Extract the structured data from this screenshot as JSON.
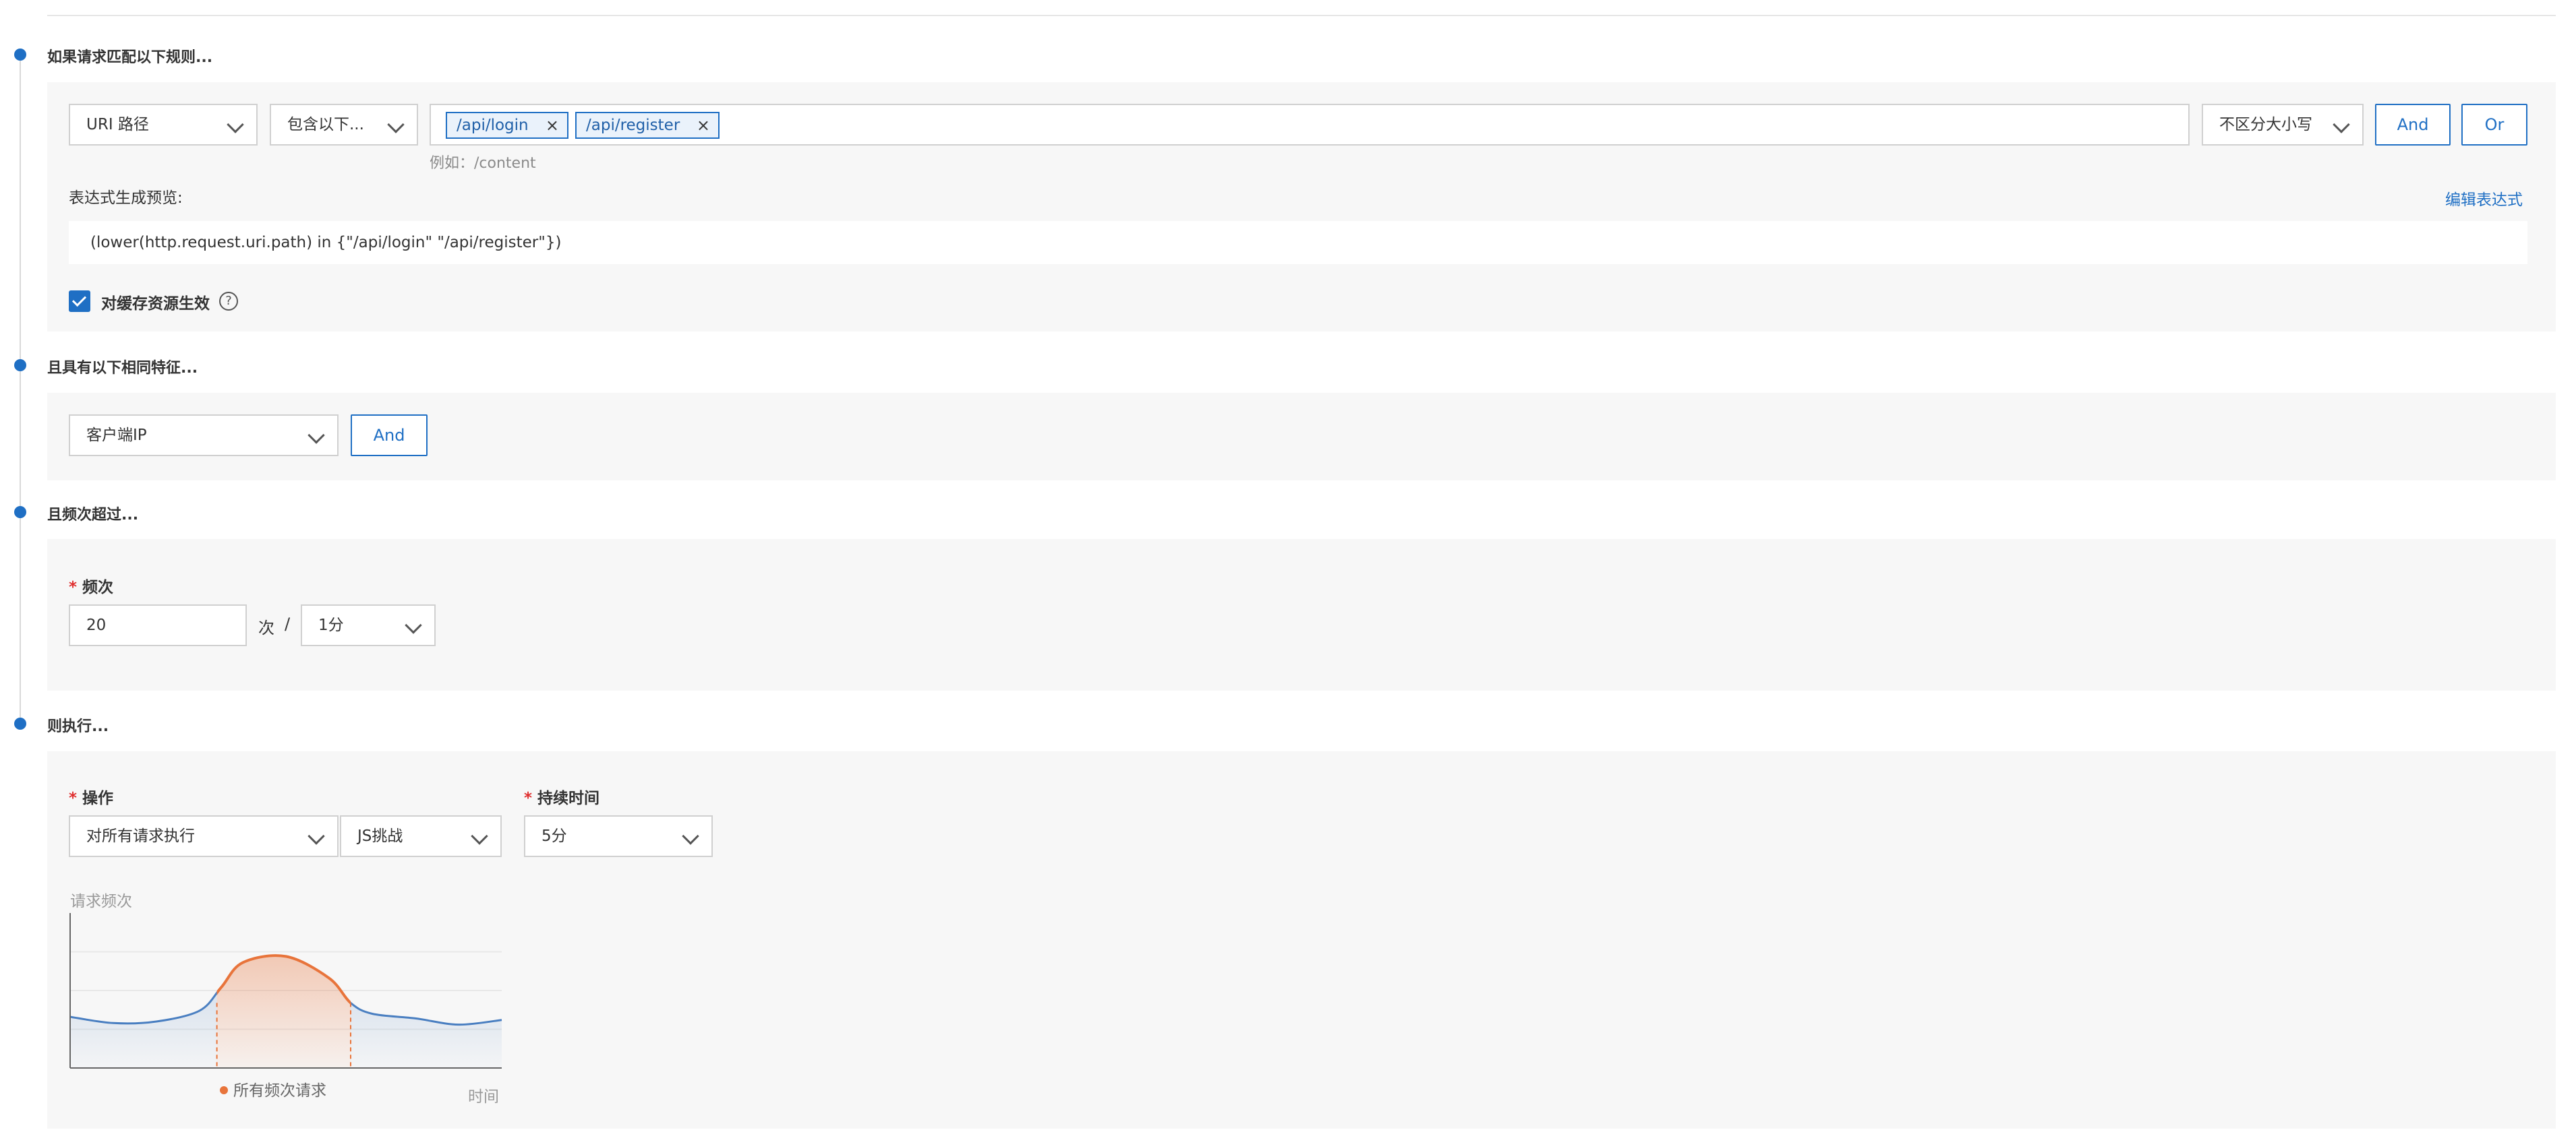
{
  "step1": {
    "title": "如果请求匹配以下规则...",
    "field_select": "URI 路径",
    "operator_select": "包含以下...",
    "tags": [
      {
        "label": "/api/login"
      },
      {
        "label": "/api/register"
      }
    ],
    "example_hint": "例如：/content",
    "case_select": "不区分大小写",
    "and_label": "And",
    "or_label": "Or",
    "preview_label": "表达式生成预览:",
    "edit_expression": "编辑表达式",
    "expression": "(lower(http.request.uri.path) in {\"/api/login\" \"/api/register\"})",
    "cache_checkbox_label": "对缓存资源生效",
    "cache_checked": true,
    "help_glyph": "?"
  },
  "step2": {
    "title": "且具有以下相同特征...",
    "feature_select": "客户端IP",
    "and_label": "And"
  },
  "step3": {
    "title": "且频次超过...",
    "required_mark": "*",
    "frequency_label": "频次",
    "frequency_value": "20",
    "times_unit": "次",
    "slash": "/",
    "period_select": "1分"
  },
  "step4": {
    "title": "则执行...",
    "required_mark": "*",
    "action_label": "操作",
    "scope_select": "对所有请求执行",
    "action_select": "JS挑战",
    "duration_label": "持续时间",
    "duration_select": "5分"
  },
  "chart_data": {
    "type": "area",
    "ylabel": "请求频次",
    "xlabel": "时间",
    "legend": [
      "所有频次请求"
    ],
    "legend_placement": "bottom",
    "grid": true,
    "highlight_color": "#e8743b",
    "base_color": "#4a7fc1",
    "series": [
      {
        "name": "所有频次请求",
        "x": [
          0,
          0.1,
          0.2,
          0.3,
          0.35,
          0.4,
          0.5,
          0.6,
          0.65,
          0.7,
          0.8,
          0.9,
          1.0
        ],
        "values": [
          0.33,
          0.29,
          0.3,
          0.37,
          0.52,
          0.68,
          0.72,
          0.58,
          0.42,
          0.35,
          0.32,
          0.28,
          0.31
        ]
      }
    ]
  },
  "colors": {
    "accent": "#1f6fc4",
    "required": "#e03030"
  }
}
